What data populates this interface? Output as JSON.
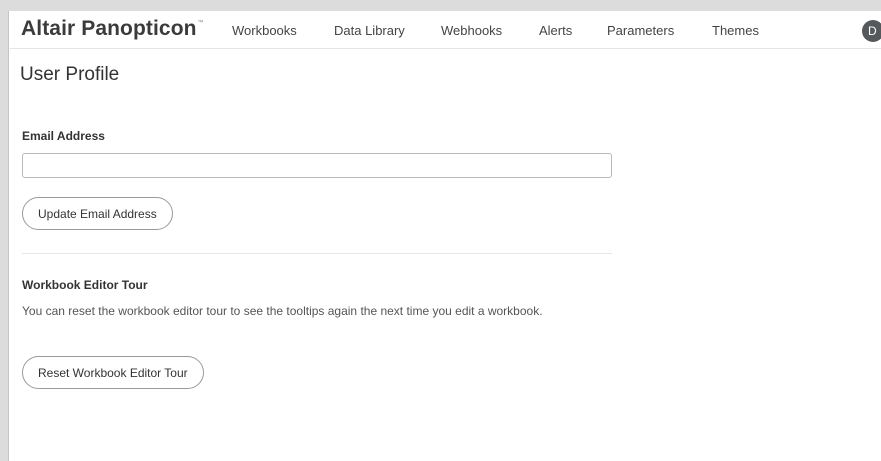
{
  "header": {
    "brand": "Altair Panopticon",
    "brand_mark": "™",
    "nav": [
      {
        "label": "Workbooks"
      },
      {
        "label": "Data Library"
      },
      {
        "label": "Webhooks"
      },
      {
        "label": "Alerts"
      },
      {
        "label": "Parameters"
      },
      {
        "label": "Themes"
      }
    ],
    "avatar_initial": "D"
  },
  "main": {
    "title": "User Profile",
    "email_section": {
      "label": "Email Address",
      "value": "",
      "button_label": "Update Email Address"
    },
    "tour_section": {
      "label": "Workbook Editor Tour",
      "description": "You can reset the workbook editor tour to see the tooltips again the next time you edit a workbook.",
      "button_label": "Reset Workbook Editor Tour"
    }
  },
  "colors": {
    "avatar_bg": "#56595c",
    "border": "#9a9a9a",
    "text": "#333333"
  }
}
